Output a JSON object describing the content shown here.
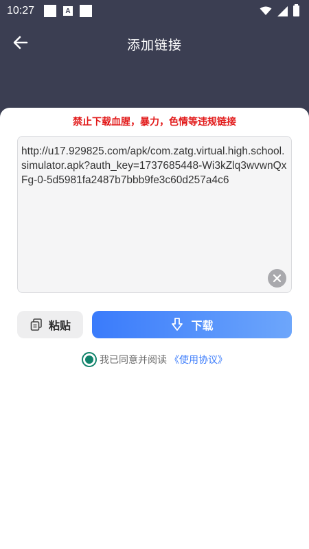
{
  "status_bar": {
    "time": "10:27",
    "notification_badge": "A",
    "icons": [
      "notification-square-icon",
      "text-a-icon",
      "notification-square-icon",
      "wifi-icon",
      "signal-icon",
      "battery-icon"
    ]
  },
  "header": {
    "title": "添加链接",
    "back_icon": "back-arrow-icon"
  },
  "form": {
    "warning": "禁止下载血腥，暴力，色情等违规链接",
    "url_value": "http://u17.929825.com/apk/com.zatg.virtual.high.school.simulator.apk?auth_key=1737685448-Wi3kZlq3wvwnQxFg-0-5d5981fa2487b7bbb9fe3c60d257a4c6",
    "clear_icon": "clear-icon",
    "paste_label": "粘贴",
    "paste_icon": "copy-icon",
    "download_label": "下载",
    "download_icon": "download-icon",
    "agreement_text": "我已同意并阅读",
    "agreement_link": "《使用协议》",
    "agreement_checked": true
  },
  "colors": {
    "header_bg": "#3b3e52",
    "warning": "#e21b1b",
    "accent_start": "#3a7bfb",
    "accent_end": "#6da6fb",
    "radio": "#11836b"
  }
}
